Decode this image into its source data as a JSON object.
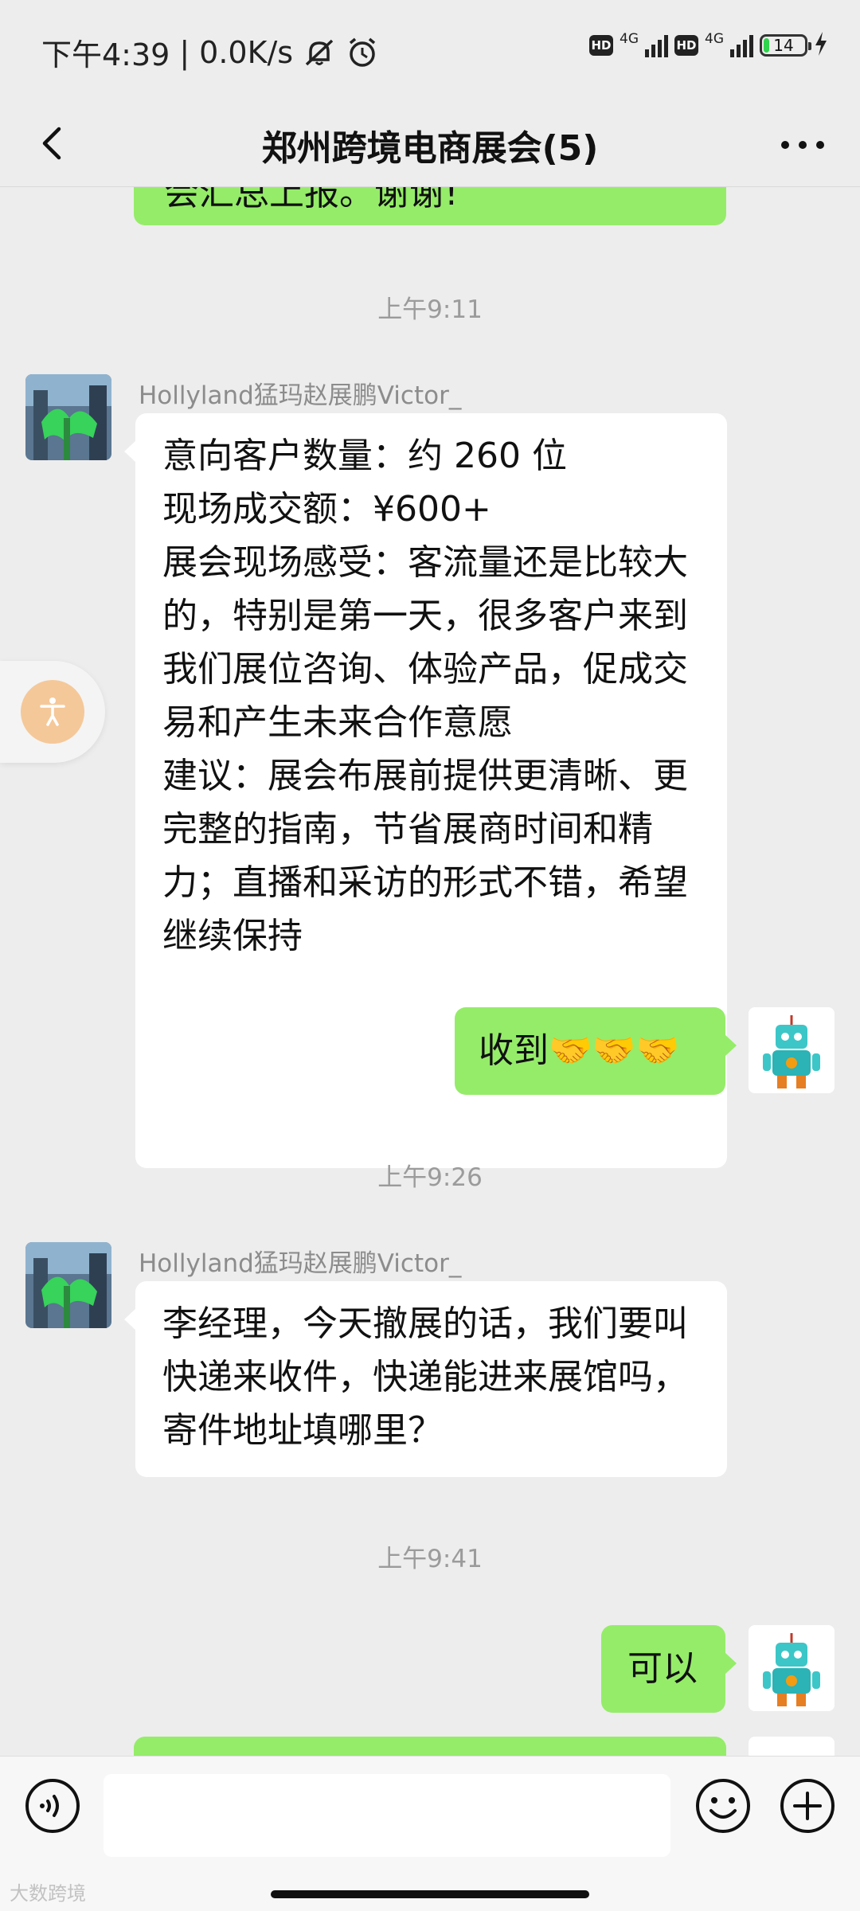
{
  "status_bar": {
    "time": "下午4:39",
    "speed": "0.0K/s",
    "hd_label": "HD",
    "network": "4G",
    "battery": "14",
    "battery_level": 0.14
  },
  "header": {
    "title": "郑州跨境电商展会(5)"
  },
  "messages": {
    "partial_top": {
      "text": "会汇总上报。谢谢!"
    },
    "ts1": "上午9:11",
    "msg1": {
      "sender": "Hollyland猛玛赵展鹏Victor_",
      "lines": [
        "意向客户数量：约 260 位",
        "现场成交额：¥600+",
        "展会现场感受：客流量还是比较大",
        "的，特别是第一天，很多客户来到",
        "我们展位咨询、体验产品，促成交",
        "易和产生未来合作意愿",
        "建议：展会布展前提供更清晰、更",
        "完整的指南，节省展商时间和精",
        "力；直播和采访的形式不错，希望",
        "继续保持"
      ]
    },
    "reply1": {
      "text": "收到🤝🤝🤝"
    },
    "ts2": "上午9:26",
    "msg2": {
      "sender": "Hollyland猛玛赵展鹏Victor_",
      "lines": [
        "李经理，今天撤展的话，我们要叫",
        "快递来收件，快递能进来展馆吗，",
        "寄件地址填哪里？"
      ]
    },
    "ts3": "上午9:41",
    "reply2": {
      "text": "可以"
    }
  },
  "input": {
    "value": ""
  },
  "watermark": "大数跨境",
  "colors": {
    "bg": "#ededed",
    "bubble_green": "#95ec69",
    "bubble_white": "#ffffff",
    "battery_green": "#2fd34d"
  }
}
